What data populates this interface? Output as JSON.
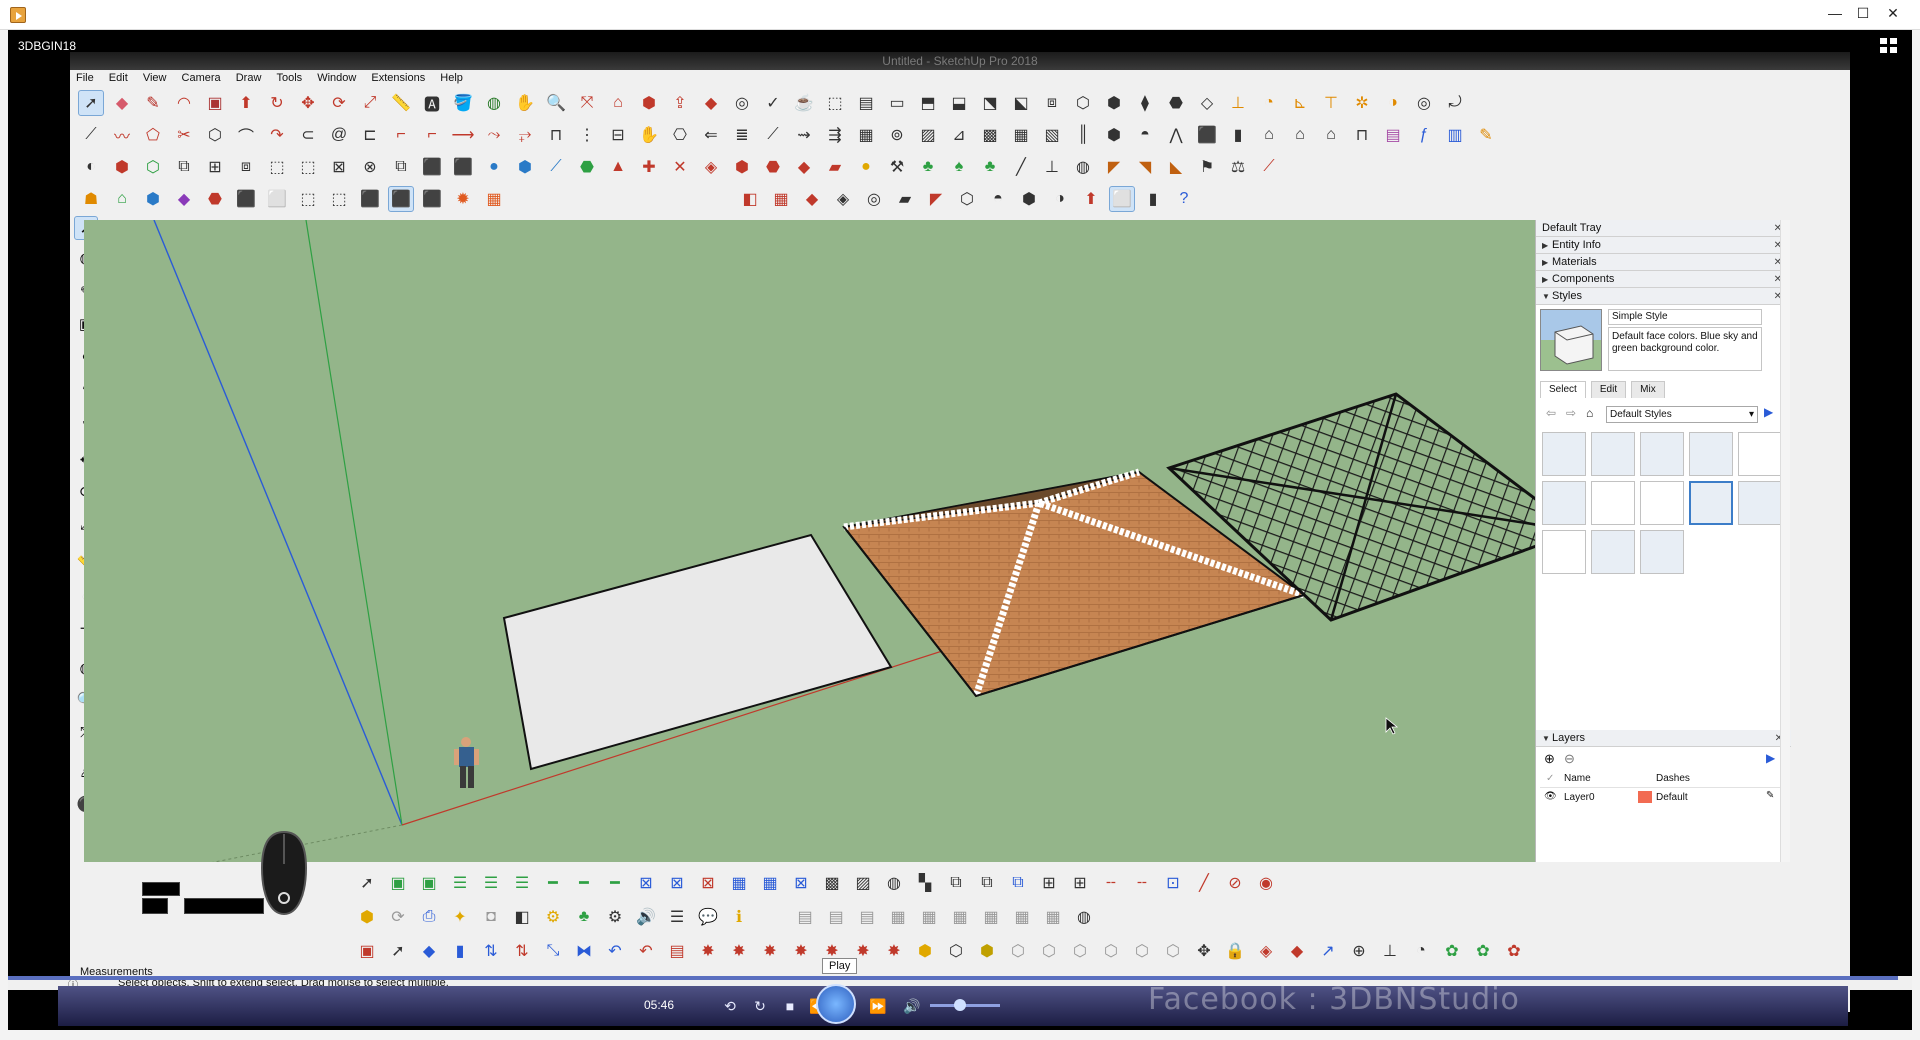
{
  "player": {
    "window_controls": {
      "minimize": "—",
      "maximize": "☐",
      "close": "✕"
    },
    "video_label": "3DBGIN18",
    "time": "05:46",
    "play_tooltip": "Play",
    "watermark": "Facebook : 3DBNStudio"
  },
  "sketchup": {
    "title": "Untitled - SketchUp Pro 2018",
    "menu": [
      "File",
      "Edit",
      "View",
      "Camera",
      "Draw",
      "Tools",
      "Window",
      "Extensions",
      "Help"
    ],
    "measurements_label": "Measurements",
    "status_text": "Select objects. Shift to extend select. Drag mouse to select multiple."
  },
  "tray": {
    "title": "Default Tray",
    "sections": [
      "Entity Info",
      "Materials",
      "Components",
      "Styles"
    ],
    "style_name": "Simple Style",
    "style_description": "Default face colors. Blue sky and green background color.",
    "tabs": [
      "Select",
      "Edit",
      "Mix"
    ],
    "style_collection": "Default Styles",
    "layers": {
      "title": "Layers",
      "columns": [
        "Name",
        "Dashes"
      ],
      "rows": [
        {
          "name": "Layer0",
          "dashes": "Default",
          "color": "#f26b52"
        }
      ]
    }
  },
  "colors": {
    "viewport_bg": "#94b58a",
    "roof_fill": "#c68552",
    "ridge_white": "#ffffff",
    "axis_red": "#c0392b",
    "axis_green": "#2ea043",
    "axis_blue": "#2a5bd7"
  }
}
